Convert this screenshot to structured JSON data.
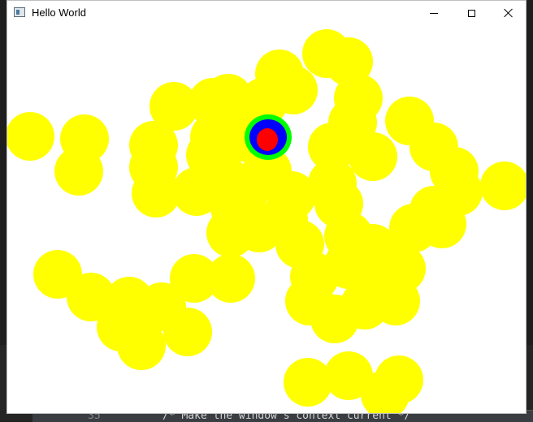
{
  "window": {
    "title": "Hello World",
    "controls": {
      "minimize": "minimize",
      "maximize": "maximize",
      "close": "close"
    }
  },
  "editor_background": {
    "line_number": "35",
    "code_text": "/* Make the window's context current */"
  },
  "canvas": {
    "background_color": "#ffffff",
    "circle_color": "#ffff00",
    "center_blob": {
      "outer_color": "#00ff00",
      "middle_color": "#0000ff",
      "inner_color": "#ff0000"
    }
  }
}
